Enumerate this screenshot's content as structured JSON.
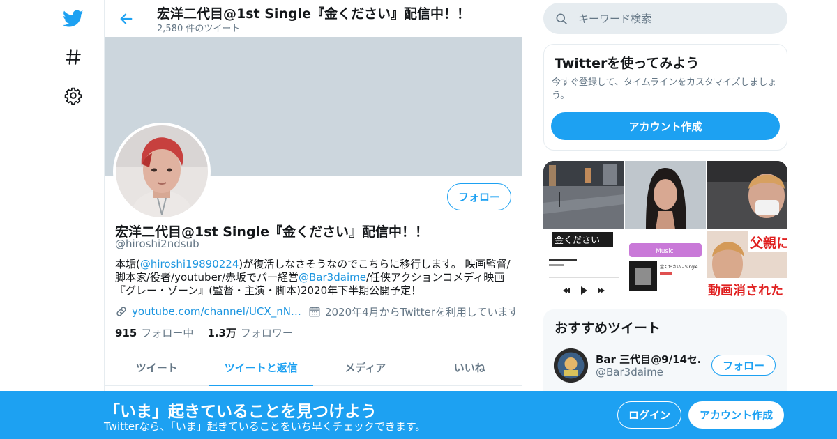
{
  "colors": {
    "accent": "#1da1f2",
    "banner": "#ccd6dd",
    "secondary_text": "#657786"
  },
  "nav": {
    "items": [
      {
        "icon": "twitter-bird-icon"
      },
      {
        "icon": "hashtag-icon"
      },
      {
        "icon": "gear-icon"
      }
    ]
  },
  "header": {
    "title": "宏洋二代目@1st Single『金ください』配信中！！",
    "tweet_count": "2,580 件のツイート"
  },
  "profile": {
    "follow_label": "フォロー",
    "name": "宏洋二代目@1st Single『金ください』配信中！！",
    "handle": "@hiroshi2ndsub",
    "bio": {
      "part1": "本垢(",
      "mention1": "@hiroshi19890224",
      "part2": ")が復活しなさそうなのでこちらに移行します。 映画監督/脚本家/役者/youtuber/赤坂でバー経営",
      "mention2": "@Bar3daime",
      "part3": "/任侠アクションコメディ映画『グレー・ゾーン』(監督・主演・脚本)2020年下半期公開予定！"
    },
    "website": "youtube.com/channel/UCX_nN…",
    "joined": "2020年4月からTwitterを利用しています",
    "following_count": "915",
    "following_label": "フォロー中",
    "followers_count": "1.3万",
    "followers_label": "フォロワー"
  },
  "tabs": [
    {
      "label": "ツイート",
      "active": false
    },
    {
      "label": "ツイートと返信",
      "active": true
    },
    {
      "label": "メディア",
      "active": false
    },
    {
      "label": "いいね",
      "active": false
    }
  ],
  "search": {
    "placeholder": "キーワード検索"
  },
  "signup_card": {
    "title": "Twitterを使ってみよう",
    "text": "今すぐ登録して、タイムラインをカスタマイズしましょう。",
    "button": "アカウント作成"
  },
  "media": {
    "thumb4_text": "金ください",
    "thumb5_label": "Music",
    "thumb5_song": "金ください - Single",
    "thumb6_text1": "父親に",
    "thumb6_text2": "動画消された"
  },
  "recommended": {
    "title": "おすすめツイート",
    "name": "Bar 三代目@9/14セ…",
    "handle": "@Bar3daime",
    "follow_label": "フォロー"
  },
  "bottom_bar": {
    "title": "「いま」起きていることを見つけよう",
    "subtitle": "Twitterなら、「いま」起きていることをいち早くチェックできます。",
    "login": "ログイン",
    "signup": "アカウント作成"
  }
}
